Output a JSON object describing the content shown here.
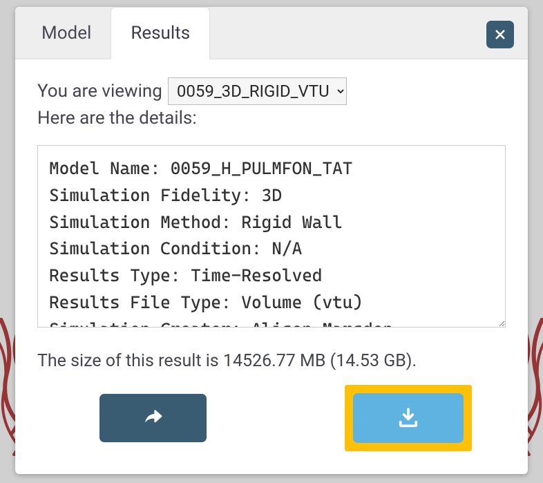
{
  "tabs": {
    "model": "Model",
    "results": "Results",
    "active": "results"
  },
  "viewing_label": "You are viewing",
  "select": {
    "value": "0059_3D_RIGID_VTU",
    "options": [
      "0059_3D_RIGID_VTU"
    ]
  },
  "details_label": "Here are the details:",
  "details_text": "Model Name: 0059_H_PULMFON_TAT\nSimulation Fidelity: 3D\nSimulation Method: Rigid Wall\nSimulation Condition: N/A\nResults Type: Time-Resolved\nResults File Type: Volume (vtu)\nSimulation Creator: Alison Marsden",
  "size_line": "The size of this result is 14526.77 MB (14.53 GB).",
  "size_mb": 14526.77,
  "size_gb": 14.53,
  "colors": {
    "dark_button": "#3a5c72",
    "download_button": "#5fb3e0",
    "highlight_ring": "#ffc107",
    "tab_bg": "#eeeeee",
    "text": "#45454f"
  },
  "icons": {
    "close": "close-icon",
    "share": "share-icon",
    "download": "download-icon"
  }
}
